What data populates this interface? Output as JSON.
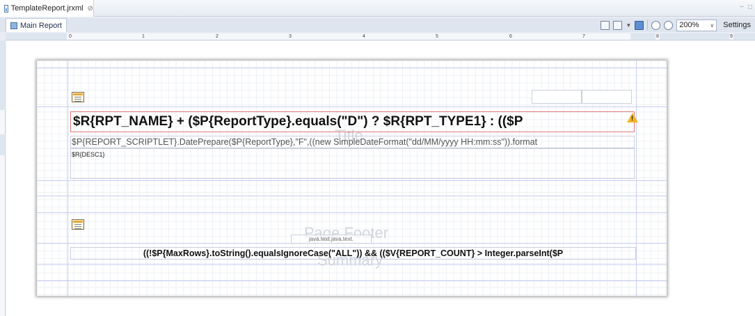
{
  "editor_tab": {
    "title": "TemplateReport.jrxml",
    "close_glyph": "⊘"
  },
  "window_controls": {
    "minimize": "−",
    "maximize": "□"
  },
  "sub_tab": {
    "label": "Main Report"
  },
  "toolbar": {
    "zoom_value": "200%",
    "settings_label": "Settings"
  },
  "ruler": {
    "numbers": [
      "0",
      "1",
      "2",
      "3",
      "4",
      "5",
      "6",
      "7",
      "8",
      "9"
    ]
  },
  "bands": {
    "title_label": "Title",
    "page_footer_label": "Page Footer",
    "summary_label": "Summary"
  },
  "fields": {
    "title_expression": "$R{RPT_NAME} + ($P{ReportType}.equals(\"D\") ? $R{RPT_TYPE1} : (($P",
    "date_expression": "$P{REPORT_SCRIPTLET}.DatePrepare($P{ReportType},\"F\",((new SimpleDateFormat(\"dd/MM/yyyy HH:mm:ss\")).format",
    "desc_expression": "$R{DESC1}",
    "java_text": "java.text.java.text.",
    "summary_expression": "((!$P{MaxRows}.toString().equalsIgnoreCase(\"ALL\")) && (($V{REPORT_COUNT} > Integer.parseInt($P"
  },
  "colors": {
    "title_border": "#e27a7a",
    "warning": "#f0b429",
    "guide_lines": "#c7cdf2"
  }
}
